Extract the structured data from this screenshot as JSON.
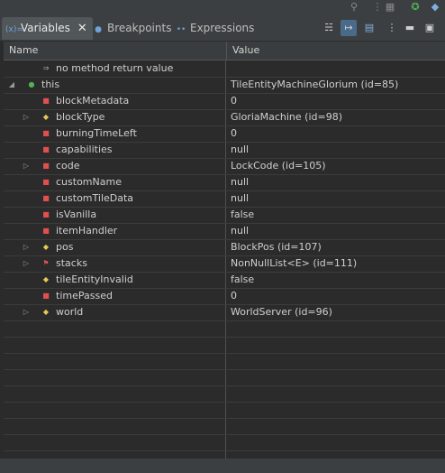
{
  "tabs": [
    {
      "label": "Variables",
      "icon": "variables-icon",
      "active": true,
      "closable": true
    },
    {
      "label": "Breakpoints",
      "icon": "breakpoints-icon",
      "active": false
    },
    {
      "label": "Expressions",
      "icon": "expressions-icon",
      "active": false
    }
  ],
  "toolbar": [
    "show-type-names-icon",
    "collapse-all-icon",
    "layout-icon",
    "view-menu-icon",
    "minimize-icon",
    "maximize-icon"
  ],
  "columns": {
    "name": "Name",
    "value": "Value"
  },
  "rows": [
    {
      "name": "no method return value",
      "value": "",
      "indent": 1,
      "icon": "return-icon",
      "expand": ""
    },
    {
      "name": "this",
      "value": "TileEntityMachineGlorium  (id=85)",
      "indent": 0,
      "icon": "green-dot-icon",
      "expand": "open"
    },
    {
      "name": "blockMetadata",
      "value": "0",
      "indent": 1,
      "icon": "red-square-icon",
      "expand": ""
    },
    {
      "name": "blockType",
      "value": "GloriaMachine  (id=98)",
      "indent": 1,
      "icon": "yellow-diamond-icon",
      "expand": "closed"
    },
    {
      "name": "burningTimeLeft",
      "value": "0",
      "indent": 1,
      "icon": "red-square-icon",
      "expand": ""
    },
    {
      "name": "capabilities",
      "value": "null",
      "indent": 1,
      "icon": "red-square-icon",
      "expand": ""
    },
    {
      "name": "code",
      "value": "LockCode  (id=105)",
      "indent": 1,
      "icon": "red-square-icon",
      "expand": "closed"
    },
    {
      "name": "customName",
      "value": "null",
      "indent": 1,
      "icon": "red-square-icon",
      "expand": ""
    },
    {
      "name": "customTileData",
      "value": "null",
      "indent": 1,
      "icon": "red-square-icon",
      "expand": ""
    },
    {
      "name": "isVanilla",
      "value": "false",
      "indent": 1,
      "icon": "red-square-icon",
      "expand": ""
    },
    {
      "name": "itemHandler",
      "value": "null",
      "indent": 1,
      "icon": "red-square-icon",
      "expand": ""
    },
    {
      "name": "pos",
      "value": "BlockPos  (id=107)",
      "indent": 1,
      "icon": "yellow-diamond-icon",
      "expand": "closed"
    },
    {
      "name": "stacks",
      "value": "NonNullList<E>  (id=111)",
      "indent": 1,
      "icon": "red-flag-icon",
      "expand": "closed"
    },
    {
      "name": "tileEntityInvalid",
      "value": "false",
      "indent": 1,
      "icon": "yellow-diamond-icon",
      "expand": ""
    },
    {
      "name": "timePassed",
      "value": "0",
      "indent": 1,
      "icon": "red-square-icon",
      "expand": ""
    },
    {
      "name": "world",
      "value": "WorldServer  (id=96)",
      "indent": 1,
      "icon": "yellow-diamond-icon",
      "expand": "closed"
    }
  ]
}
